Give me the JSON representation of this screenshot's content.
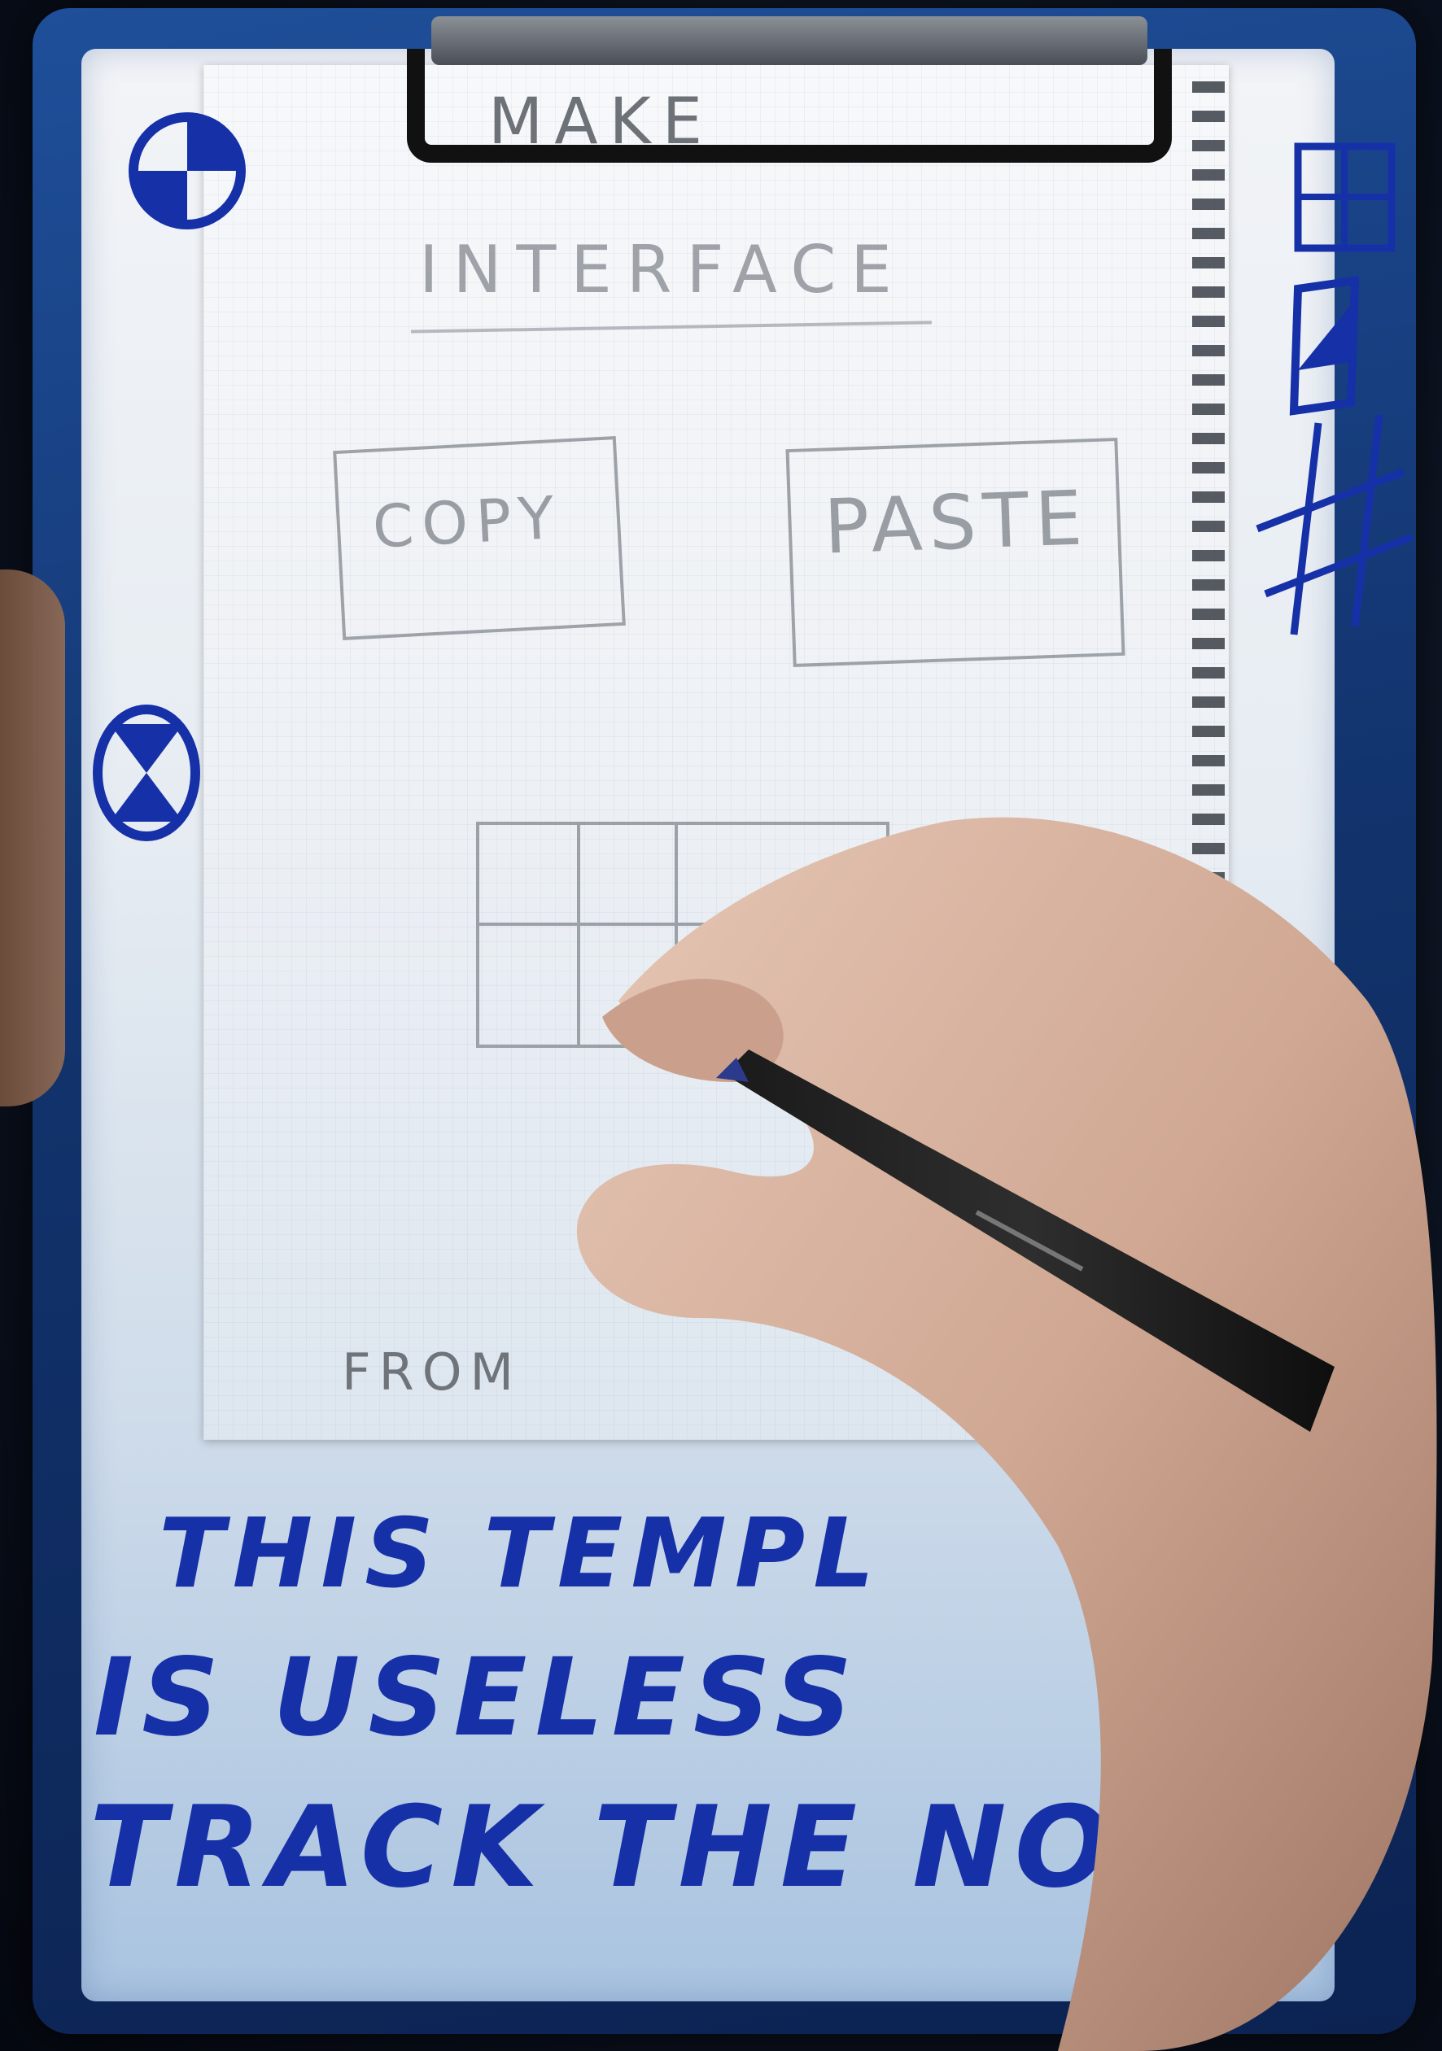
{
  "notebook": {
    "title": "MAKE",
    "subtitle": "INTERFACE",
    "copy_label": "COPY",
    "paste_label": "PASTE",
    "footer": "FROM"
  },
  "handwritten_message": {
    "line_1": "THIS TEMPL",
    "line_2": "IS USELESS",
    "line_3": "TRACK THE NOTE"
  },
  "colors": {
    "ink_blue": "#1630a8",
    "clipboard_blue": "#12336d",
    "pencil_gray": "#8a8f96"
  },
  "icons": {
    "top_left": "circle-quarter-icon",
    "mid_left": "circle-hourglass-icon",
    "top_right": "grid-four-icon",
    "right_checkbox": "checkbox-checked-icon",
    "right_hash": "hash-grid-icon"
  }
}
